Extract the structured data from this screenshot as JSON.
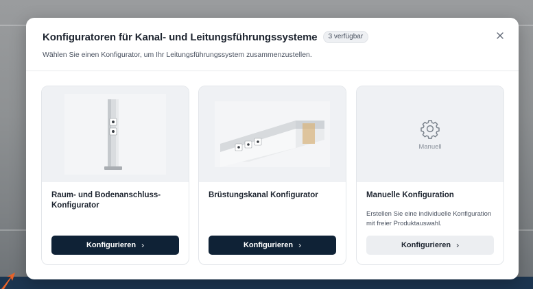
{
  "modal": {
    "title": "Konfiguratoren für Kanal- und Leitungsführungssysteme",
    "badge": "3 verfügbar",
    "subtitle": "Wählen Sie einen Konfigurator, um Ihr Leitungsführungssystem zusammenzustellen.",
    "close_icon": "close-icon"
  },
  "cards": [
    {
      "title": "Raum- und Bodenanschluss-Konfigurator",
      "button_label": "Konfigurieren",
      "button_chevron": "›",
      "image": "floor-column-product-image"
    },
    {
      "title": "Brüstungskanal Konfigurator",
      "button_label": "Konfigurieren",
      "button_chevron": "›",
      "image": "parapet-channel-product-image"
    },
    {
      "title": "Manuelle Konfiguration",
      "description": "Erstellen Sie eine individuelle Konfiguration mit freier Produktauswahl.",
      "media_label": "Manuell",
      "button_label": "Konfigurieren",
      "button_chevron": "›",
      "icon": "gear-icon"
    }
  ],
  "colors": {
    "primary_dark": "#0f2236",
    "card_media_bg": "#eff1f4",
    "overlay_band": "#1c3550",
    "accent_arrow": "#e8632a"
  }
}
